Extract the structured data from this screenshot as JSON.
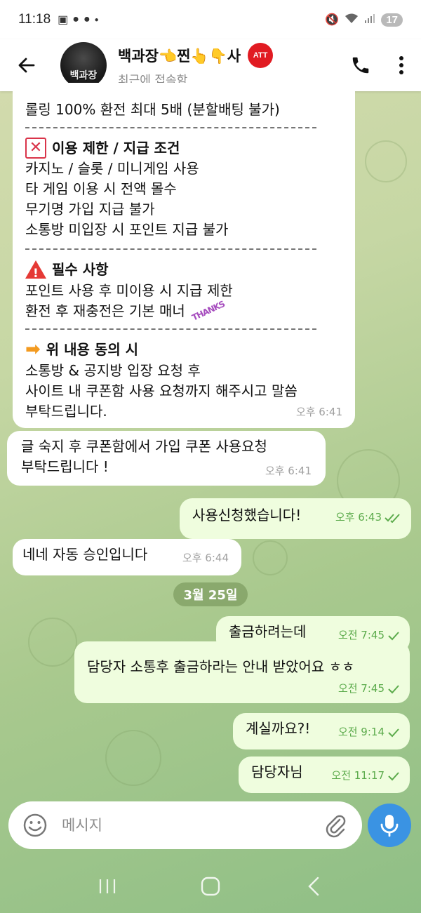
{
  "status_bar": {
    "time": "11:18",
    "battery": "17"
  },
  "header": {
    "title": "백과장👈찐👆👇사",
    "subtitle": "최근에 접속함",
    "avatar_text": "백과장",
    "badge": "ATT"
  },
  "big_message": {
    "line_partial": "롤링 100% 환전 최대 5배 (분할배팅 불가)",
    "section1_title": "이용 제한 / 지급 조건",
    "section1_lines": [
      "카지노 / 슬롯 / 미니게임 사용",
      "타 게임 이용 시 전액 몰수",
      "무기명 가입 지급 불가",
      "소통방 미입장 시 포인트 지급 불가"
    ],
    "section2_title": "필수 사항",
    "section2_lines": [
      "포인트 사용 후 미이용 시 지급 제한",
      "환전 후 재충전은 기본 매너"
    ],
    "sticker_text": "THANKS",
    "section3_title": "위 내용 동의 시",
    "section3_lines": [
      "소통방 & 공지방 입장 요청 후",
      "사이트 내 쿠폰함 사용 요청까지 해주시고 말씀",
      "부탁드립니다."
    ],
    "time": "오후 6:41"
  },
  "messages": [
    {
      "dir": "in",
      "lines": [
        "글 숙지 후 쿠폰함에서 가입 쿠폰 사용요청",
        "부탁드립니다 !"
      ],
      "time": "오후 6:41"
    },
    {
      "dir": "out",
      "lines": [
        "사용신청했습니다!"
      ],
      "time": "오후 6:43"
    },
    {
      "dir": "in",
      "lines": [
        "네네 자동 승인입니다"
      ],
      "time": "오후 6:44"
    },
    {
      "dir": "out",
      "lines": [
        "출금하려는데"
      ],
      "time": "오전 7:45"
    },
    {
      "dir": "out",
      "lines": [
        "담당자 소통후 출금하라는 안내 받았어요 ㅎㅎ"
      ],
      "time": "오전 7:45"
    },
    {
      "dir": "out",
      "lines": [
        "계실까요?!"
      ],
      "time": "오전 9:14"
    },
    {
      "dir": "out",
      "lines": [
        "담당자님"
      ],
      "time": "오전 11:17"
    }
  ],
  "date_divider": "3월 25일",
  "input": {
    "placeholder": "메시지"
  },
  "colors": {
    "outgoing_bubble": "#effdde",
    "incoming_bubble": "#ffffff",
    "accent": "#3a93e3",
    "check_green": "#5cab4c",
    "att_red": "#e11b22"
  },
  "icons": [
    "back-arrow-icon",
    "phone-icon",
    "more-vertical-icon",
    "emoji-icon",
    "paperclip-icon",
    "microphone-icon",
    "double-check-icon",
    "check-icon",
    "recent-apps-icon",
    "home-icon",
    "back-nav-icon"
  ]
}
